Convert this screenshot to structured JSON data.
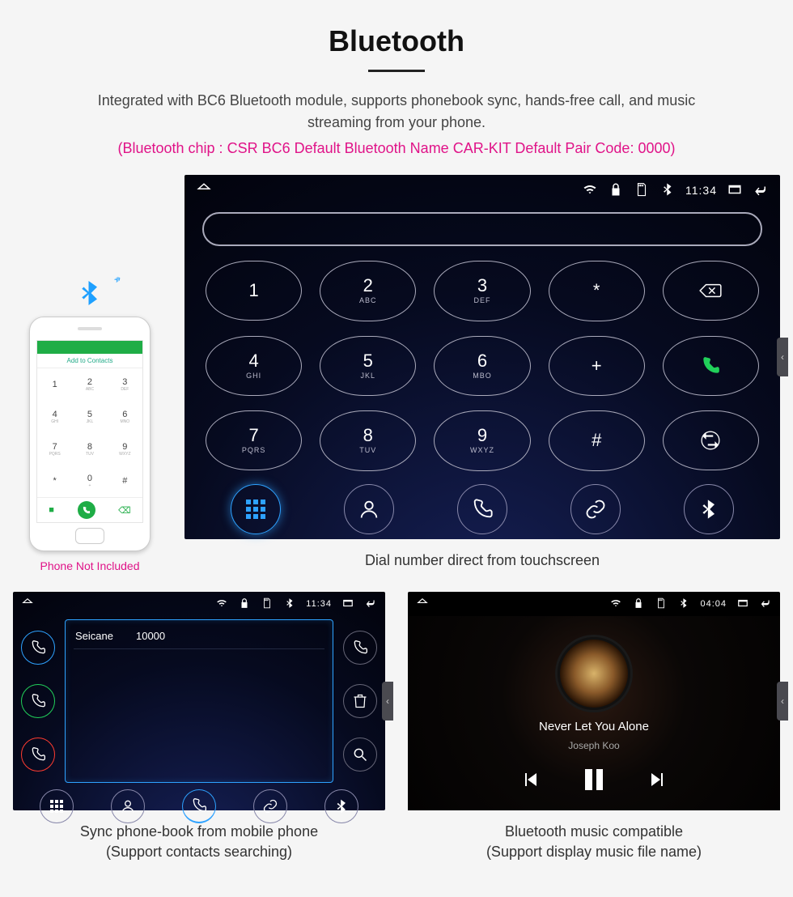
{
  "header": {
    "title": "Bluetooth",
    "description": "Integrated with BC6 Bluetooth module, supports phonebook sync, hands-free call, and music streaming from your phone.",
    "specs": "(Bluetooth chip : CSR BC6     Default Bluetooth Name CAR-KIT     Default Pair Code: 0000)"
  },
  "phone_preview": {
    "add_to_contacts": "Add to Contacts",
    "note": "Phone Not Included",
    "keys": [
      {
        "n": "1",
        "s": ""
      },
      {
        "n": "2",
        "s": "ABC"
      },
      {
        "n": "3",
        "s": "DEF"
      },
      {
        "n": "4",
        "s": "GHI"
      },
      {
        "n": "5",
        "s": "JKL"
      },
      {
        "n": "6",
        "s": "MNO"
      },
      {
        "n": "7",
        "s": "PQRS"
      },
      {
        "n": "8",
        "s": "TUV"
      },
      {
        "n": "9",
        "s": "WXYZ"
      },
      {
        "n": "*",
        "s": ""
      },
      {
        "n": "0",
        "s": "+"
      },
      {
        "n": "#",
        "s": ""
      }
    ]
  },
  "main_screen": {
    "status_time": "11:34",
    "keypad": [
      {
        "n": "1",
        "s": ""
      },
      {
        "n": "2",
        "s": "ABC"
      },
      {
        "n": "3",
        "s": "DEF"
      },
      {
        "n": "*",
        "s": ""
      },
      {
        "special": "backspace"
      },
      {
        "n": "4",
        "s": "GHI"
      },
      {
        "n": "5",
        "s": "JKL"
      },
      {
        "n": "6",
        "s": "MBO"
      },
      {
        "n": "+",
        "s": ""
      },
      {
        "special": "call"
      },
      {
        "n": "7",
        "s": "PQRS"
      },
      {
        "n": "8",
        "s": "TUV"
      },
      {
        "n": "9",
        "s": "WXYZ"
      },
      {
        "n": "#",
        "s": ""
      },
      {
        "special": "swap"
      }
    ],
    "caption": "Dial number direct from touchscreen"
  },
  "phonebook_screen": {
    "status_time": "11:34",
    "contact_name": "Seicane",
    "contact_number": "10000",
    "caption_line1": "Sync phone-book from mobile phone",
    "caption_line2": "(Support contacts searching)"
  },
  "music_screen": {
    "status_time": "04:04",
    "song_title": "Never Let You Alone",
    "artist": "Joseph Koo",
    "caption_line1": "Bluetooth music compatible",
    "caption_line2": "(Support display music file name)"
  }
}
